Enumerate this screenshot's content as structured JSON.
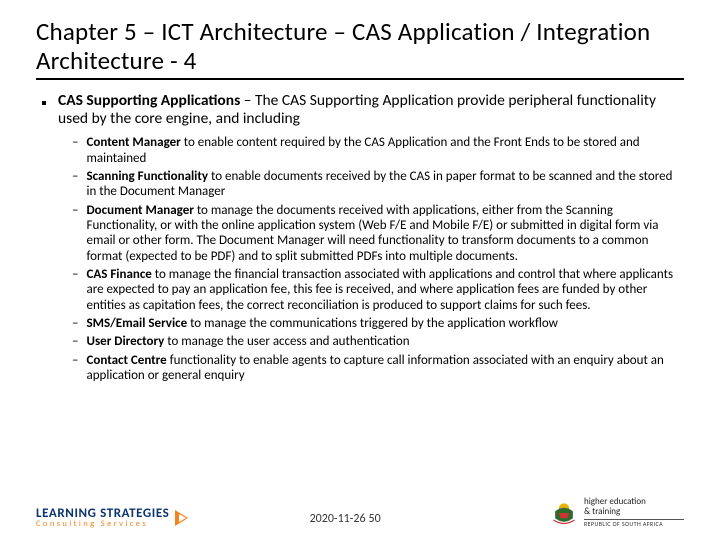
{
  "title": "Chapter 5 – ICT Architecture – CAS Application / Integration Architecture - 4",
  "bullet": {
    "lead_bold": "CAS Supporting Applications",
    "lead_rest": " – The CAS Supporting Application provide peripheral functionality used by the core engine, and including"
  },
  "subs": [
    {
      "bold": "Content Manager",
      "rest": " to enable content required by the CAS Application and the Front Ends to be stored and maintained"
    },
    {
      "bold": "Scanning Functionality",
      "rest": " to enable documents received by the CAS in paper format to be scanned and the stored in the Document Manager"
    },
    {
      "bold": "Document Manager",
      "rest": " to manage the documents received with applications, either from the Scanning Functionality, or with the online application system (Web F/E and Mobile F/E) or submitted in digital form via email or other form. The Document Manager will need functionality to transform documents to a common format (expected to be PDF) and to split submitted PDFs into multiple documents."
    },
    {
      "bold": "CAS Finance",
      "rest": " to manage the financial transaction associated with applications and control that where applicants are expected to pay an application fee, this fee is received, and where application fees are funded by other entities as capitation fees, the correct reconciliation is produced to support claims for such fees."
    },
    {
      "bold": "SMS/Email Service",
      "rest": " to manage the communications triggered by the application workflow"
    },
    {
      "bold": "User Directory",
      "rest": " to manage the user access and authentication"
    },
    {
      "bold": "Contact Centre",
      "rest": " functionality to enable agents to capture call information associated with an enquiry about an application or general enquiry"
    }
  ],
  "footer": {
    "date": "2020-11-26",
    "page": "50",
    "ls_line1": "LEARNING STRATEGIES",
    "ls_line2": "Consulting Services",
    "het_l1": "higher education",
    "het_l2": "& training",
    "het_sub": "REPUBLIC OF SOUTH AFRICA"
  }
}
